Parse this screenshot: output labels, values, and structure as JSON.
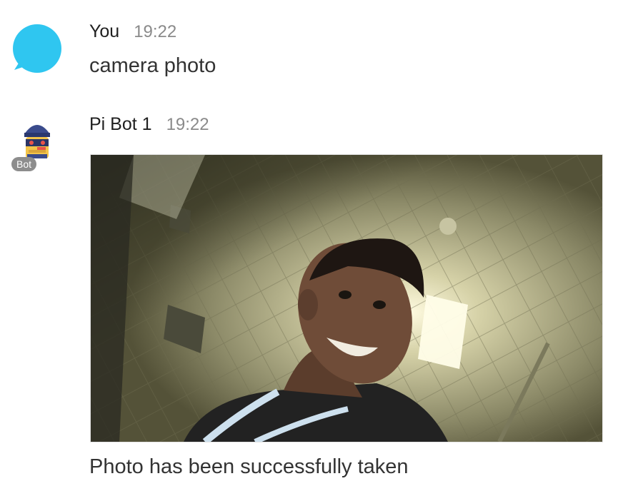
{
  "messages": [
    {
      "sender": "You",
      "time": "19:22",
      "text": "camera photo",
      "avatar_icon": "speech-bubble-icon",
      "avatar_color": "#2fc6f0"
    },
    {
      "sender": "Pi Bot 1",
      "time": "19:22",
      "badge": "Bot",
      "avatar_icon": "bot-avatar-icon",
      "attachment": {
        "type": "image",
        "description_icon": "camera-photo-image"
      },
      "caption": "Photo has been successfully taken"
    }
  ]
}
